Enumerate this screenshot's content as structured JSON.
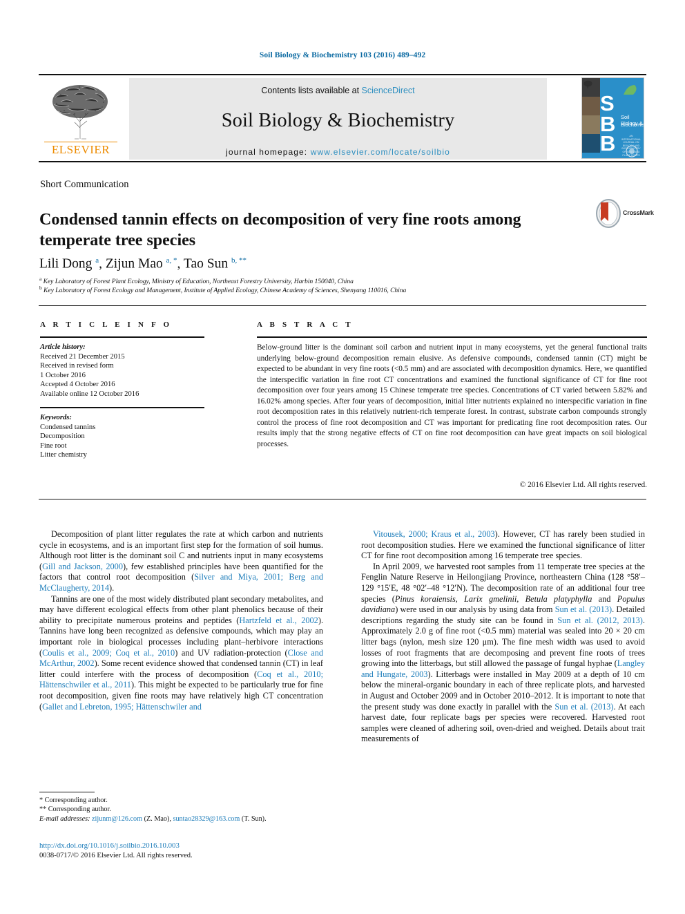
{
  "running_head": "Soil Biology & Biochemistry 103 (2016) 489–492",
  "masthead": {
    "publisher_name": "ELSEVIER",
    "contents_prefix": "Contents lists available at ",
    "contents_link": "ScienceDirect",
    "journal_title": "Soil Biology & Biochemistry",
    "homepage_label": "journal homepage: ",
    "homepage_url": "www.elsevier.com/locate/soilbio",
    "cover": {
      "letters": [
        "S",
        "B",
        "B"
      ],
      "caption_line1": "Soil Biology &",
      "caption_line2": "Biochemistry",
      "fine_print": "AN INTERNATIONAL JOURNAL ON\nBIOLOGY AND BIOCHEMISTRY\nOF SOILS AND PLANT ROOTS"
    }
  },
  "article": {
    "type": "Short Communication",
    "title": "Condensed tannin effects on decomposition of very fine roots among temperate tree species",
    "crossmark_label": "CrossMark",
    "authors_html": "Lili Dong <sup>a</sup>, Zijun Mao <sup>a, *</sup>, Tao Sun <sup>b, **</sup>",
    "affiliation_a": "Key Laboratory of Forest Plant Ecology, Ministry of Education, Northeast Forestry University, Harbin 150040, China",
    "affiliation_b": "Key Laboratory of Forest Ecology and Management, Institute of Applied Ecology, Chinese Academy of Sciences, Shenyang 110016, China"
  },
  "info": {
    "heading": "A R T I C L E  I N F O",
    "history_label": "Article history:",
    "history": [
      "Received 21 December 2015",
      "Received in revised form",
      "1 October 2016",
      "Accepted 4 October 2016",
      "Available online 12 October 2016"
    ],
    "keywords_label": "Keywords:",
    "keywords": [
      "Condensed tannins",
      "Decomposition",
      "Fine root",
      "Litter chemistry"
    ]
  },
  "abstract": {
    "heading": "A B S T R A C T",
    "text": "Below-ground litter is the dominant soil carbon and nutrient input in many ecosystems, yet the general functional traits underlying below-ground decomposition remain elusive. As defensive compounds, condensed tannin (CT) might be expected to be abundant in very fine roots (<0.5 mm) and are associated with decomposition dynamics. Here, we quantified the interspecific variation in fine root CT concentrations and examined the functional significance of CT for fine root decomposition over four years among 15 Chinese temperate tree species. Concentrations of CT varied between 5.82% and 16.02% among species. After four years of decomposition, initial litter nutrients explained no interspecific variation in fine root decomposition rates in this relatively nutrient-rich temperate forest. In contrast, substrate carbon compounds strongly control the process of fine root decomposition and CT was important for predicating fine root decomposition rates. Our results imply that the strong negative effects of CT on fine root decomposition can have great impacts on soil biological processes.",
    "copyright": "© 2016 Elsevier Ltd. All rights reserved."
  },
  "body": {
    "left_paragraphs": [
      [
        {
          "t": "Decomposition of plant litter regulates the rate at which carbon and nutrients cycle in ecosystems, and is an important first step for the formation of soil humus. Although root litter is the dominant soil C and nutrients input in many ecosystems ("
        },
        {
          "t": "Gill and Jackson, 2000",
          "ref": true
        },
        {
          "t": "), few established principles have been quantified for the factors that control root decomposition ("
        },
        {
          "t": "Silver and Miya, 2001; Berg and McClaugherty, 2014",
          "ref": true
        },
        {
          "t": ")."
        }
      ],
      [
        {
          "t": "Tannins are one of the most widely distributed plant secondary metabolites, and may have different ecological effects from other plant phenolics because of their ability to precipitate numerous proteins and peptides ("
        },
        {
          "t": "Hartzfeld et al., 2002",
          "ref": true
        },
        {
          "t": "). Tannins have long been recognized as defensive compounds, which may play an important role in biological processes including plant–herbivore interactions ("
        },
        {
          "t": "Coulis et al., 2009; Coq et al., 2010",
          "ref": true
        },
        {
          "t": ") and UV radiation-protection ("
        },
        {
          "t": "Close and McArthur, 2002",
          "ref": true
        },
        {
          "t": "). Some recent evidence showed that condensed tannin (CT) in leaf litter could interfere with the process of decomposition ("
        },
        {
          "t": "Coq et al., 2010; Hättenschwiler et al., 2011",
          "ref": true
        },
        {
          "t": "). This might be expected to be particularly true for fine root decomposition, given fine roots may have relatively high CT concentration ("
        },
        {
          "t": "Gallet and Lebreton, 1995; Hättenschwiler and",
          "ref": true
        }
      ]
    ],
    "right_paragraphs": [
      [
        {
          "t": "Vitousek, 2000; Kraus et al., 2003",
          "ref": true
        },
        {
          "t": "). However, CT has rarely been studied in root decomposition studies. Here we examined the functional significance of litter CT for fine root decomposition among 16 temperate tree species."
        }
      ],
      [
        {
          "t": "In April 2009, we harvested root samples from 11 temperate tree species at the Fenglin Nature Reserve in Heilongjiang Province, northeastern China (128 °58′–129 °15′E, 48 °02′–48 °12′N). The decomposition rate of an additional four tree species ("
        },
        {
          "t": "Pinus koraiensis, Larix gmelinii, Betula platyphylla",
          "italic": true
        },
        {
          "t": " and "
        },
        {
          "t": "Populus davidiana",
          "italic": true
        },
        {
          "t": ") were used in our analysis by using data from "
        },
        {
          "t": "Sun et al. (2013)",
          "ref": true
        },
        {
          "t": ". Detailed descriptions regarding the study site can be found in "
        },
        {
          "t": "Sun et al. (2012, 2013)",
          "ref": true
        },
        {
          "t": ". Approximately 2.0 g of fine root (<0.5 mm) material was sealed into 20 × 20 cm litter bags (nylon, mesh size 120 μm). The fine mesh width was used to avoid losses of root fragments that are decomposing and prevent fine roots of trees growing into the litterbags, but still allowed the passage of fungal hyphae ("
        },
        {
          "t": "Langley and Hungate, 2003",
          "ref": true
        },
        {
          "t": "). Litterbags were installed in May 2009 at a depth of 10 cm below the mineral-organic boundary in each of three replicate plots, and harvested in August and October 2009 and in October 2010–2012. It is important to note that the present study was done exactly in parallel with the "
        },
        {
          "t": "Sun et al. (2013)",
          "ref": true
        },
        {
          "t": ". At each harvest date, four replicate bags per species were recovered. Harvested root samples were cleaned of adhering soil, oven-dried and weighed. Details about trait measurements of"
        }
      ]
    ]
  },
  "footnotes": {
    "star1": "* Corresponding author.",
    "star2": "** Corresponding author.",
    "email_label": "E-mail addresses:",
    "email1": "zijunm@126.com",
    "email1_who": "(Z. Mao)",
    "email2": "suntao28329@163.com",
    "email2_who": "(T. Sun)",
    "doi": "http://dx.doi.org/10.1016/j.soilbio.2016.10.003",
    "issn_line": "0038-0717/© 2016 Elsevier Ltd. All rights reserved."
  },
  "colors": {
    "link_blue": "#1a7bb9",
    "head_blue": "#0b6aa2",
    "elsevier_orange": "#ED8B00",
    "cover_blue": "#2a8fc9",
    "crossmark_red": "#b32317"
  }
}
